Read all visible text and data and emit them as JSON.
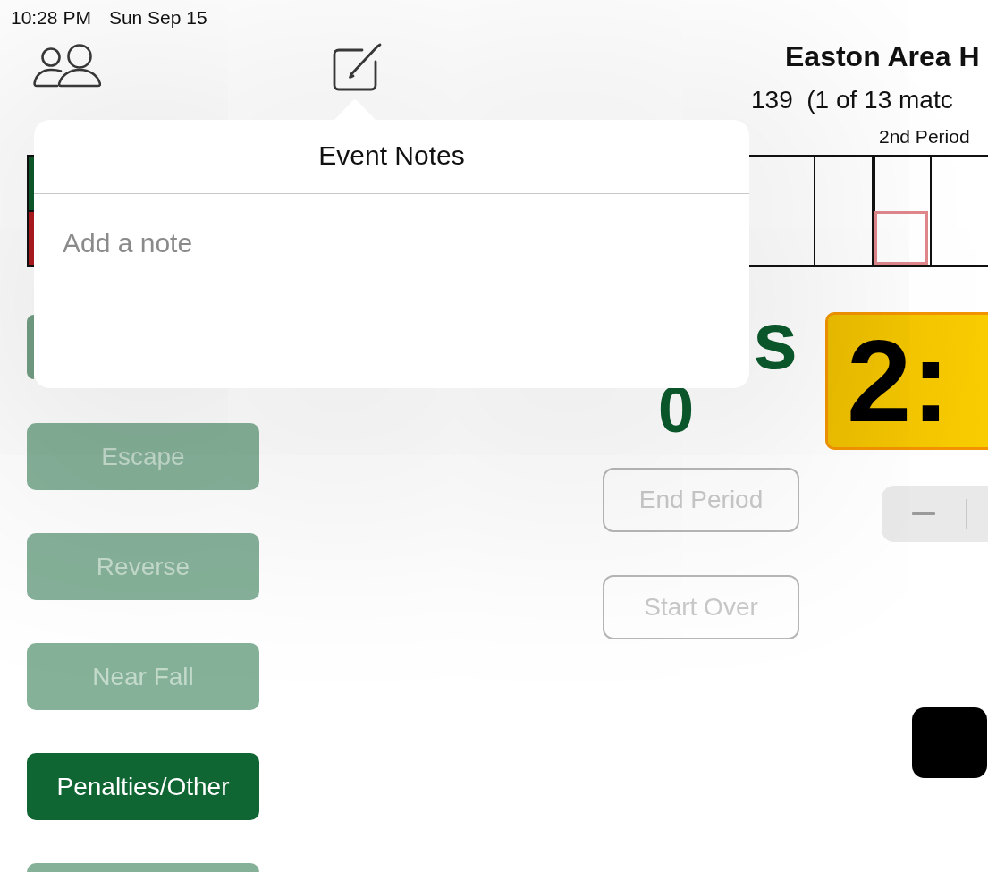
{
  "status_bar": {
    "time": "10:28 PM",
    "date": "Sun Sep 15"
  },
  "header": {
    "title": "Easton Area H",
    "subtitle": "139  (1 of 13 matc",
    "period": "2nd Period"
  },
  "score_sheet": {
    "wrestlers": [
      {
        "color": "#0d5a2c"
      },
      {
        "color": "#b01a1e"
      }
    ],
    "columns": [
      {
        "selected": false
      },
      {
        "selected": true
      },
      {
        "selected": false
      }
    ]
  },
  "actions": [
    {
      "disabled": true
    },
    {
      "label": "Escape",
      "disabled": true
    },
    {
      "label": "Reverse",
      "disabled": true
    },
    {
      "label": "Near Fall",
      "disabled": true
    },
    {
      "label": "Penalties/Other",
      "disabled": false
    },
    {
      "disabled": true
    }
  ],
  "scoreboard": {
    "name": "s",
    "score": "0"
  },
  "controls": [
    {
      "label": "End Period",
      "disabled": true
    },
    {
      "label": "Start Over",
      "disabled": true
    }
  ],
  "timer": {
    "display": "2:"
  },
  "popover": {
    "title": "Event Notes",
    "note": {
      "placeholder": "Add a note"
    }
  }
}
